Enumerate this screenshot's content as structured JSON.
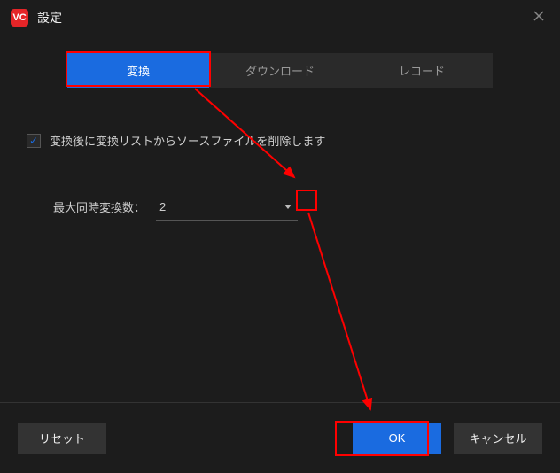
{
  "window": {
    "title": "設定",
    "app_icon_text": "VC"
  },
  "tabs": {
    "convert": "変換",
    "download": "ダウンロード",
    "record": "レコード"
  },
  "checkbox_label": "変換後に変換リストからソースファイルを削除します",
  "max_concurrent": {
    "label": "最大同時変換数：",
    "value": "2"
  },
  "buttons": {
    "reset": "リセット",
    "ok": "OK",
    "cancel": "キャンセル"
  }
}
